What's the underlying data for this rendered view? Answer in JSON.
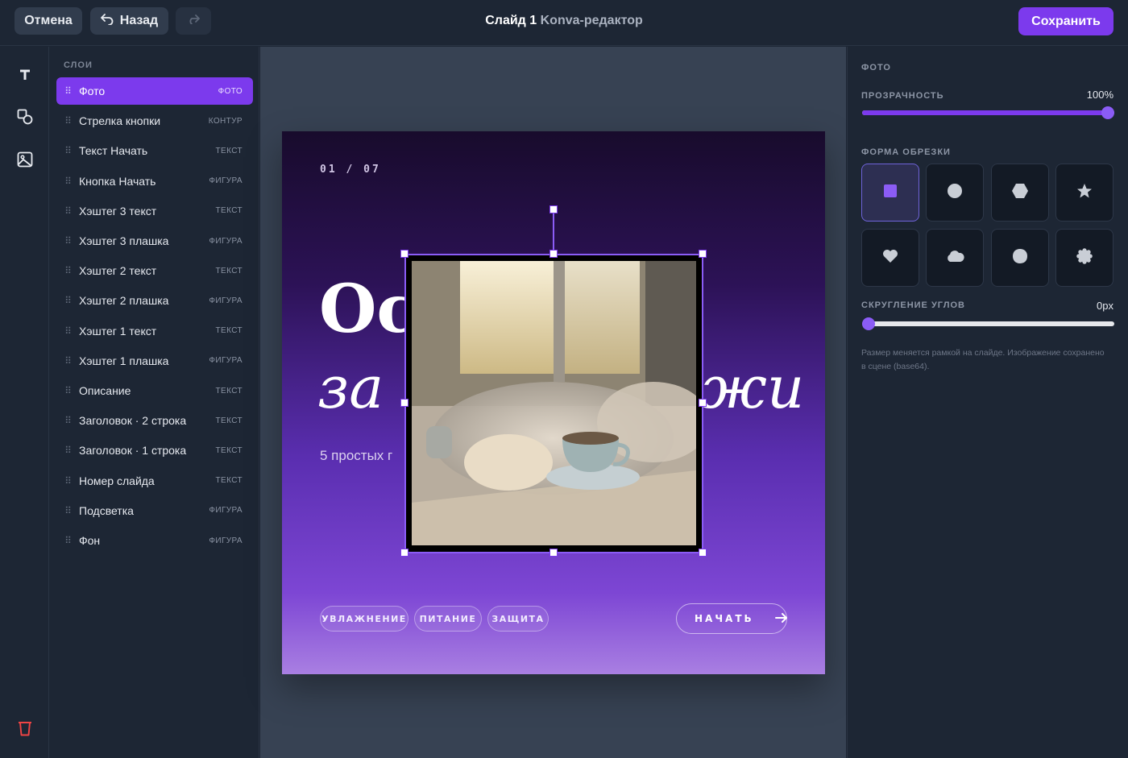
{
  "topbar": {
    "cancel_label": "Отмена",
    "back_label": "Назад",
    "title_main": "Слайд 1",
    "title_sub": "Konva-редактор",
    "save_label": "Сохранить"
  },
  "tools": [
    "text-tool",
    "shapes-tool",
    "image-tool",
    "delete-tool"
  ],
  "layers": {
    "title": "СЛОИ",
    "items": [
      {
        "name": "Фото",
        "type": "ФОТО",
        "active": true
      },
      {
        "name": "Стрелка кнопки",
        "type": "КОНТУР"
      },
      {
        "name": "Текст Начать",
        "type": "ТЕКСТ"
      },
      {
        "name": "Кнопка Начать",
        "type": "ФИГУРА"
      },
      {
        "name": "Хэштег 3 текст",
        "type": "ТЕКСТ"
      },
      {
        "name": "Хэштег 3 плашка",
        "type": "ФИГУРА"
      },
      {
        "name": "Хэштег 2 текст",
        "type": "ТЕКСТ"
      },
      {
        "name": "Хэштег 2 плашка",
        "type": "ФИГУРА"
      },
      {
        "name": "Хэштег 1 текст",
        "type": "ТЕКСТ"
      },
      {
        "name": "Хэштег 1 плашка",
        "type": "ФИГУРА"
      },
      {
        "name": "Описание",
        "type": "ТЕКСТ"
      },
      {
        "name": "Заголовок · 2 строка",
        "type": "ТЕКСТ"
      },
      {
        "name": "Заголовок · 1 строка",
        "type": "ТЕКСТ"
      },
      {
        "name": "Номер слайда",
        "type": "ТЕКСТ"
      },
      {
        "name": "Подсветка",
        "type": "ФИГУРА"
      },
      {
        "name": "Фон",
        "type": "ФИГУРА"
      }
    ]
  },
  "slide": {
    "number": "01 / 07",
    "heading_line1": "Ос",
    "heading_line2_left": "за",
    "heading_line2_right": "жи",
    "description": "5 простых г",
    "tags": [
      "УВЛАЖНЕНИЕ",
      "ПИТАНИЕ",
      "ЗАЩИТА"
    ],
    "cta_label": "НАЧАТЬ"
  },
  "props": {
    "section_title": "ФОТО",
    "opacity_label": "ПРОЗРАЧНОСТЬ",
    "opacity_value": "100%",
    "opacity_fraction": 1.0,
    "crop_shape_label": "ФОРМА ОБРЕЗКИ",
    "crop_shapes": [
      "square",
      "circle",
      "hexagon",
      "star",
      "heart",
      "cloud",
      "blob",
      "flower"
    ],
    "crop_shape_selected": "square",
    "corner_label": "СКРУГЛЕНИЕ УГЛОВ",
    "corner_value": "0px",
    "corner_fraction": 0.0,
    "hint": "Размер меняется рамкой на слайде. Изображение сохранено в сцене (base64)."
  },
  "colors": {
    "accent": "#7c3aed",
    "panel_bg": "#1d2634",
    "workspace_bg": "#374253"
  }
}
